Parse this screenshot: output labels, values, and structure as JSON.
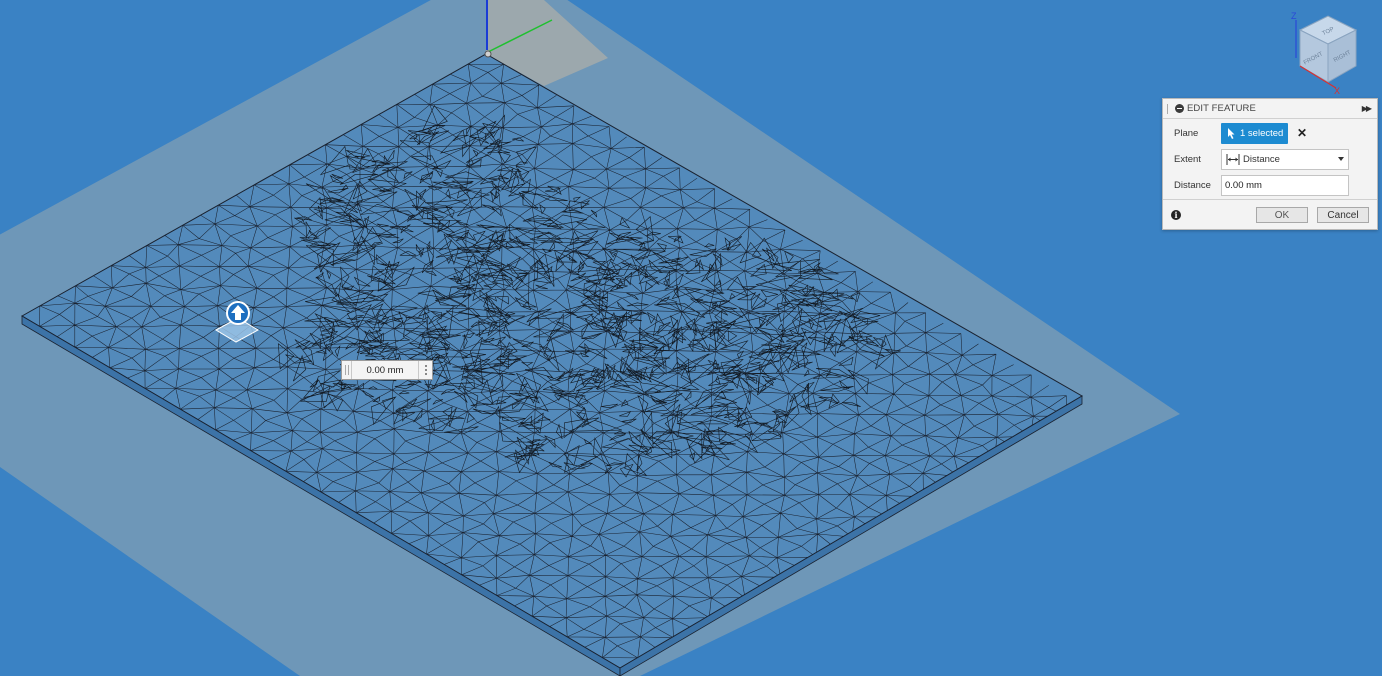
{
  "viewcube": {
    "face_top": "TOP",
    "face_front": "FRONT",
    "face_right": "RIGHT",
    "axis_z": "Z",
    "axis_x": "X"
  },
  "manipulator": {
    "value": "0.00 mm"
  },
  "dialog": {
    "title": "EDIT FEATURE",
    "plane": {
      "label": "Plane",
      "button": "1 selected"
    },
    "extent": {
      "label": "Extent",
      "value": "Distance"
    },
    "distance": {
      "label": "Distance",
      "value": "0.00 mm"
    },
    "ok": "OK",
    "cancel": "Cancel"
  },
  "colors": {
    "viewport_bg": "#3a82c4",
    "plane": "#b8b4a8",
    "mesh_line": "#1a2230",
    "selected_button": "#1d8bd1"
  }
}
